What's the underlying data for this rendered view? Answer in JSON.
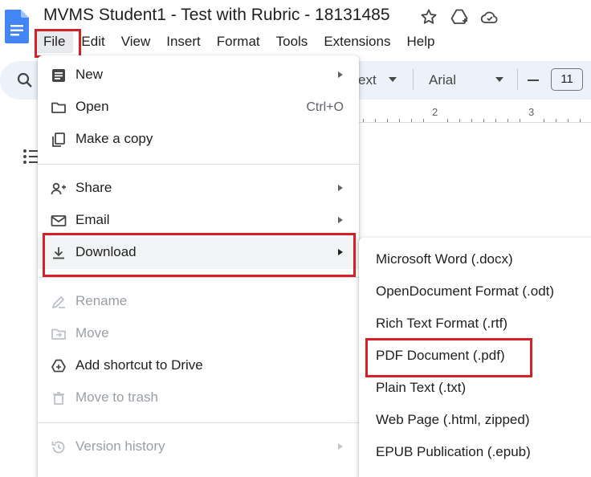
{
  "app": {
    "doc_title": "MVMS Student1 - Test with Rubric - 18131485",
    "menubar": [
      "File",
      "Edit",
      "View",
      "Insert",
      "Format",
      "Tools",
      "Extensions",
      "Help"
    ]
  },
  "toolbar": {
    "style_value": "ext",
    "font_value": "Arial",
    "font_size": "11"
  },
  "ruler": {
    "labels": [
      "2",
      "3"
    ]
  },
  "file_menu": {
    "items": [
      {
        "label": "New",
        "submenu": true,
        "enabled": true
      },
      {
        "label": "Open",
        "shortcut": "Ctrl+O",
        "enabled": true
      },
      {
        "label": "Make a copy",
        "enabled": true
      },
      {
        "label": "Share",
        "submenu": true,
        "enabled": true
      },
      {
        "label": "Email",
        "submenu": true,
        "enabled": true
      },
      {
        "label": "Download",
        "submenu": true,
        "enabled": true,
        "active": true
      },
      {
        "label": "Rename",
        "enabled": false
      },
      {
        "label": "Move",
        "enabled": false
      },
      {
        "label": "Add shortcut to Drive",
        "enabled": true
      },
      {
        "label": "Move to trash",
        "enabled": false
      },
      {
        "label": "Version history",
        "submenu": true,
        "enabled": false
      }
    ]
  },
  "download_submenu": {
    "items": [
      {
        "label": "Microsoft Word (.docx)"
      },
      {
        "label": "OpenDocument Format (.odt)"
      },
      {
        "label": "Rich Text Format (.rtf)"
      },
      {
        "label": "PDF Document (.pdf)",
        "highlighted": true
      },
      {
        "label": "Plain Text (.txt)"
      },
      {
        "label": "Web Page (.html, zipped)"
      },
      {
        "label": "EPUB Publication (.epub)"
      }
    ]
  },
  "colors": {
    "highlight_box": "#d62027",
    "docs_blue": "#4285f4",
    "menu_hover": "#f1f3f4",
    "disabled_text": "#9aa0a6"
  }
}
